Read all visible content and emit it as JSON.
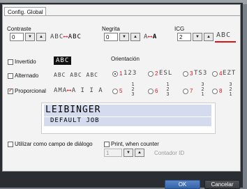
{
  "tab": {
    "label": "Config. Global"
  },
  "contraste": {
    "label": "Contraste",
    "value": "0",
    "sample_text": "ABC",
    "sample_text2": "ABC"
  },
  "negrita": {
    "label": "Negrita",
    "value": "0",
    "sample_text": "A",
    "sample_text2": "A"
  },
  "icg": {
    "label": "ICG",
    "value": "2",
    "sample_text": "ABC"
  },
  "invertido": {
    "label": "Invertido",
    "checked": false,
    "sample_text": "ABC"
  },
  "alternado": {
    "label": "Alternado",
    "checked": false,
    "sample_text": "ABC ABC ABC"
  },
  "proporcional": {
    "label": "Proporcional",
    "checked": true,
    "sample_text": "AMA",
    "sample_text2": "A I I A"
  },
  "orientacion": {
    "label": "Orientación",
    "options": [
      {
        "num": "1",
        "sample": "123",
        "selected": true
      },
      {
        "num": "2",
        "sample": "ESL",
        "selected": false
      },
      {
        "num": "3",
        "sample": "TS3",
        "selected": false
      },
      {
        "num": "4",
        "sample": "EZT",
        "selected": false
      },
      {
        "num": "5",
        "sample": "",
        "selected": false
      },
      {
        "num": "6",
        "sample": "",
        "selected": false
      },
      {
        "num": "7",
        "sample": "",
        "selected": false
      },
      {
        "num": "8",
        "sample": "",
        "selected": false
      }
    ]
  },
  "preview": {
    "line1": "LEIBINGER",
    "line2": "DEFAULT JOB"
  },
  "utilizar": {
    "label": "Utilizar como campo de diálogo",
    "checked": false
  },
  "print_counter": {
    "label": "Print, when counter",
    "checked": false,
    "value": "1",
    "sub_label": "Contador ID"
  },
  "buttons": {
    "ok": "OK",
    "cancel": "Cancelar"
  },
  "icons": {
    "increment": "▲",
    "decrement": "▼"
  },
  "colors": {
    "accent_red": "#d11111",
    "preview_bg": "#d4dbee",
    "ok_blue": "#3f6fb3"
  }
}
